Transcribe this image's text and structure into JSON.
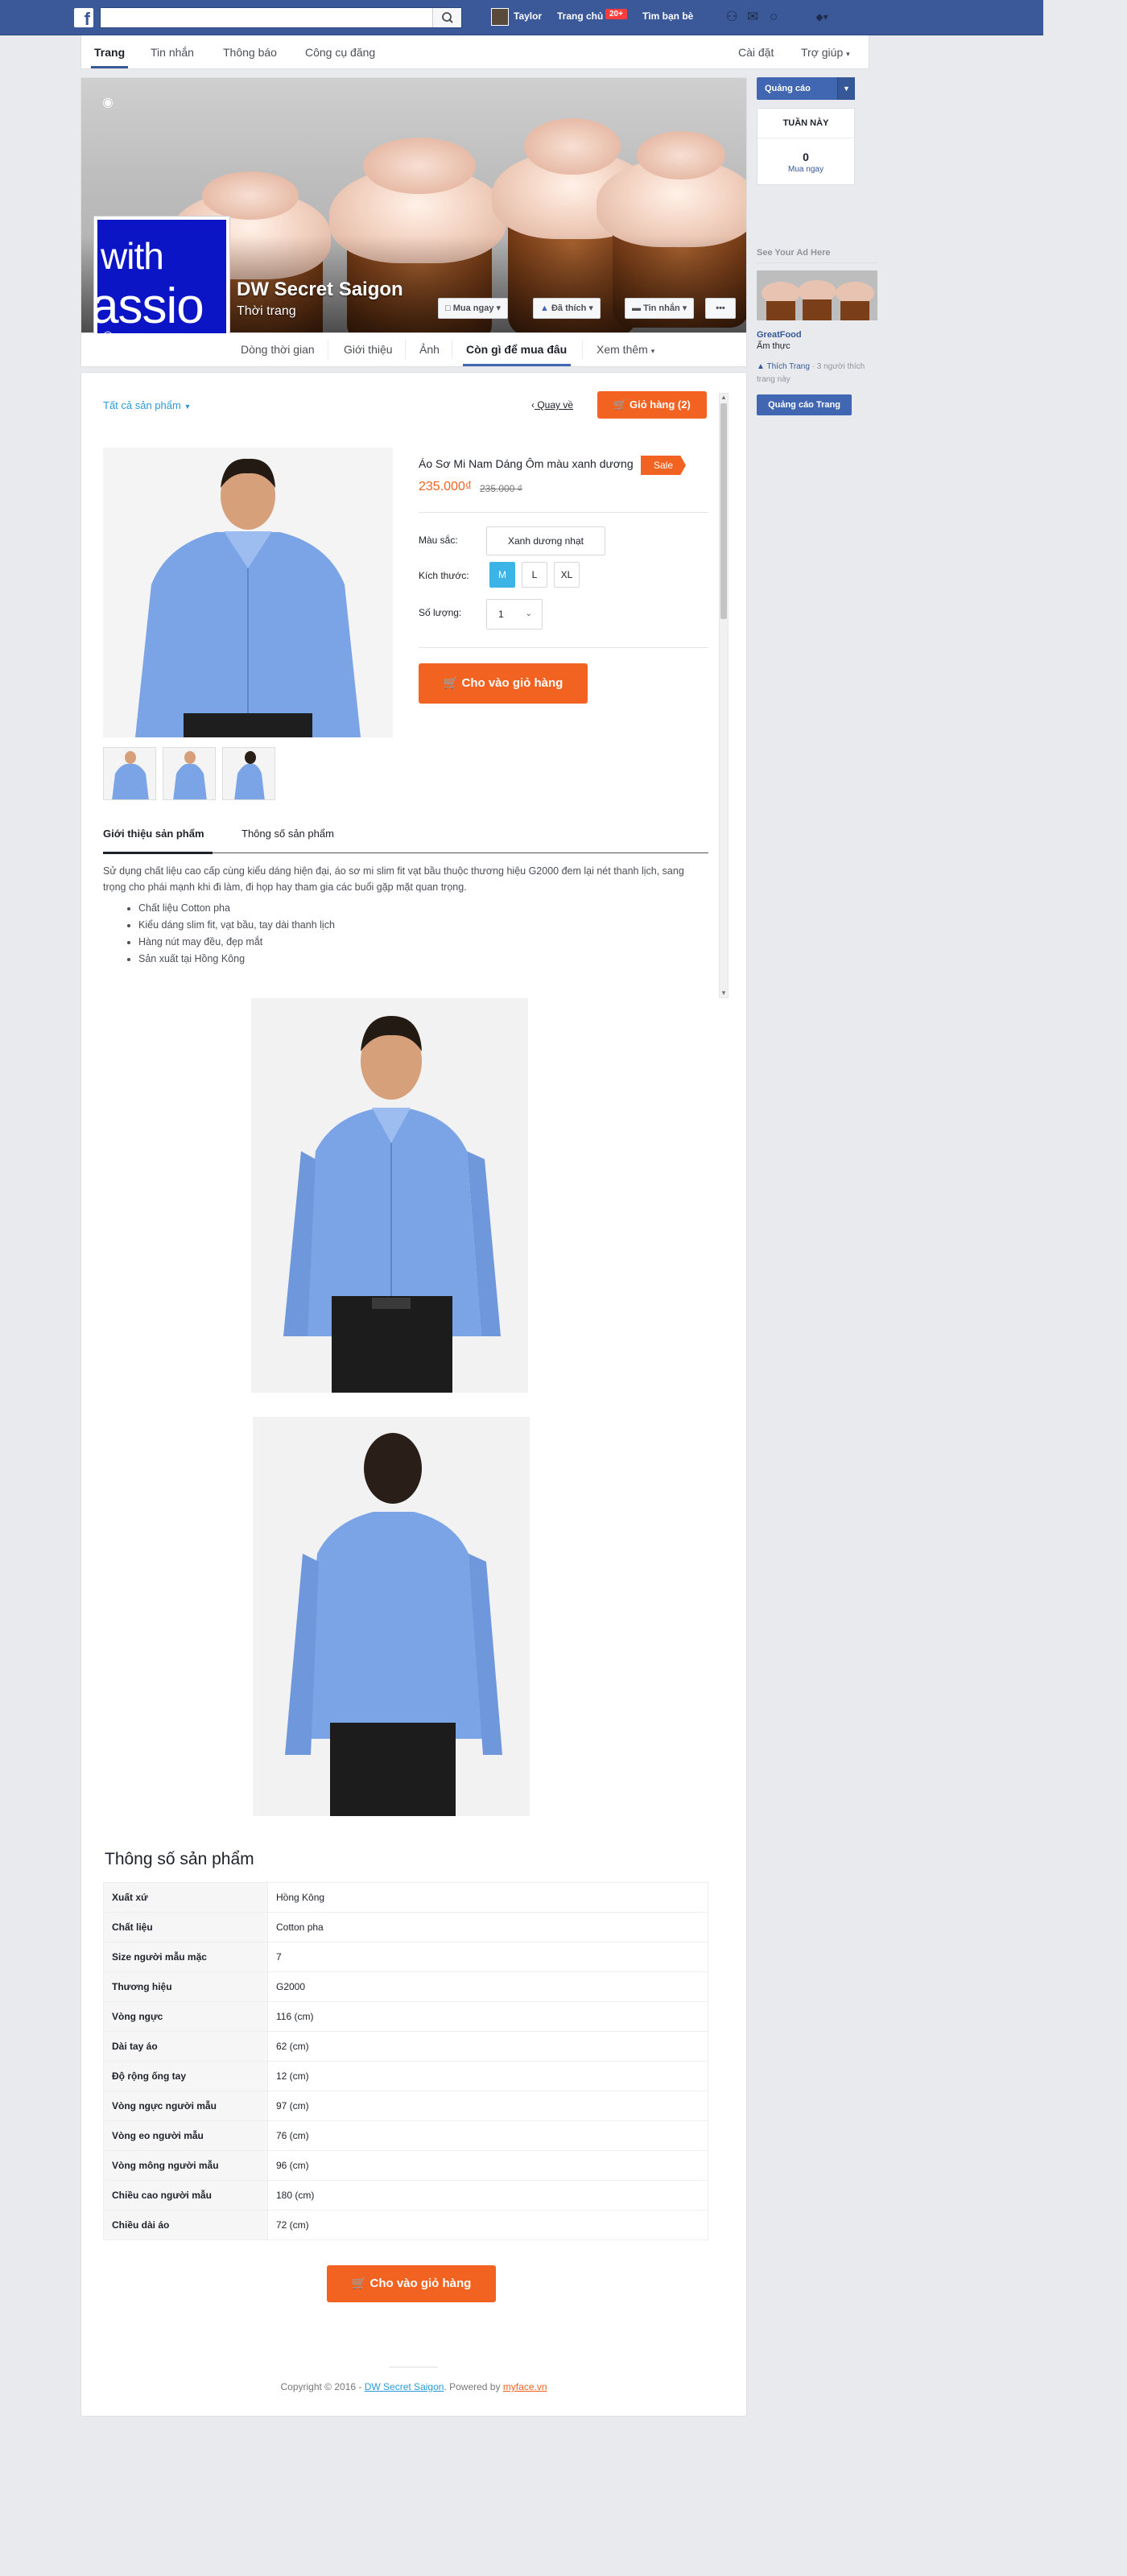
{
  "topbar": {
    "search_placeholder": "",
    "user_name": "Taylor",
    "home_label": "Trang chủ",
    "home_badge": "20+",
    "find_friends_label": "Tìm bạn bè"
  },
  "subnav": {
    "tabs": [
      {
        "label": "Trang"
      },
      {
        "label": "Tin nhắn"
      },
      {
        "label": "Thông báo"
      },
      {
        "label": "Công cụ đăng"
      }
    ],
    "settings_label": "Cài đặt",
    "help_label": "Trợ giúp"
  },
  "page": {
    "name": "DW Secret Saigon",
    "category": "Thời trang",
    "profile_text_1": "with",
    "profile_text_2": "assio",
    "buttons": {
      "shop_now": "Mua ngay",
      "liked": "Đã thích",
      "message": "Tin nhắn",
      "more": "•••"
    },
    "tabs": [
      {
        "label": "Dòng thời gian"
      },
      {
        "label": "Giới thiệu"
      },
      {
        "label": "Ảnh"
      },
      {
        "label": "Còn gì để mua đâu"
      },
      {
        "label": "Xem thêm"
      }
    ]
  },
  "shop": {
    "all_products": "Tất cả sản phẩm",
    "back": "Quay về",
    "cart": "Giỏ hàng (2)",
    "product": {
      "title": "Áo Sơ Mi Nam Dáng Ôm màu xanh dương",
      "sale_badge": "Sale",
      "price": "235.000₫",
      "old_price": "235.000 ₫",
      "color_label": "Màu sắc:",
      "color_value": "Xanh dương nhạt",
      "size_label": "Kích thước:",
      "sizes": [
        "M",
        "L",
        "XL"
      ],
      "selected_size": "M",
      "qty_label": "Số lượng:",
      "qty_value": "1",
      "add_to_cart": "Cho vào giỏ hàng"
    },
    "detail_tabs": [
      {
        "label": "Giới thiệu sản phẩm"
      },
      {
        "label": "Thông số sản phẩm"
      }
    ],
    "description": "Sử dụng chất liệu cao cấp cùng kiểu dáng hiện đại, áo sơ mi slim fit vạt bầu thuộc thương hiệu G2000 đem lại nét thanh lịch, sang trọng cho phái mạnh khi đi làm, đi họp hay tham gia các buổi gặp mặt quan trọng.",
    "bullets": [
      "Chất liệu Cotton pha",
      "Kiểu dáng slim fit, vạt bầu, tay dài thanh lịch",
      "Hàng nút may đều, đẹp mắt",
      "Sản xuất tại Hồng Kông"
    ],
    "spec_title": "Thông số sản phẩm",
    "specs": [
      {
        "k": "Xuất xứ",
        "v": "Hồng Kông"
      },
      {
        "k": "Chất liệu",
        "v": "Cotton pha"
      },
      {
        "k": "Size người mẫu mặc",
        "v": "7"
      },
      {
        "k": "Thương hiệu",
        "v": "G2000"
      },
      {
        "k": "Vòng ngực",
        "v": "116 (cm)"
      },
      {
        "k": "Dài tay áo",
        "v": "62 (cm)"
      },
      {
        "k": "Độ rộng ống tay",
        "v": "12 (cm)"
      },
      {
        "k": "Vòng ngực người mẫu",
        "v": "97 (cm)"
      },
      {
        "k": "Vòng eo người mẫu",
        "v": "76 (cm)"
      },
      {
        "k": "Vòng mông người mẫu",
        "v": "96 (cm)"
      },
      {
        "k": "Chiều cao người mẫu",
        "v": "180 (cm)"
      },
      {
        "k": "Chiều dài áo",
        "v": "72 (cm)"
      }
    ],
    "add_to_cart_bottom": "Cho vào giỏ hàng",
    "footer": {
      "prefix": "Copyright © 2016 - ",
      "shop_link": "DW Secret Saigon",
      "middle": ". Powered by ",
      "powered_link": "myface.vn"
    }
  },
  "sidebar": {
    "ads_button": "Quảng cáo",
    "week_title": "TUẦN NÀY",
    "week_count": "0",
    "week_label": "Mua ngay",
    "ad_heading": "See Your Ad Here",
    "ad_name": "GreatFood",
    "ad_category": "Ẩm thực",
    "ad_like": "Thích Trang",
    "ad_like_sub": "· 3 người thích trang này",
    "promote_button": "Quảng cáo Trang"
  },
  "colors": {
    "facebook_blue": "#3b5998",
    "accent_orange": "#f26322",
    "link_blue": "#2c9ad8",
    "size_selected": "#3cb4e6"
  }
}
